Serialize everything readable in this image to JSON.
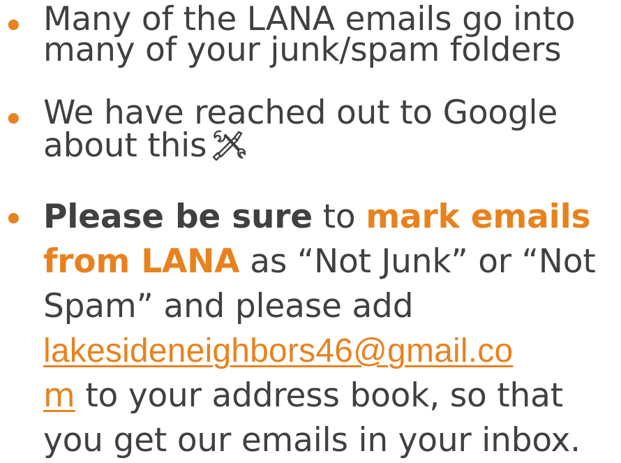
{
  "bullets": [
    {
      "lines": [
        "Many of the LANA emails go into",
        "many of your junk/spam folders"
      ]
    },
    {
      "line1": "We have reached out to Google",
      "line2": "about this",
      "icon": "tools-icon"
    },
    {
      "line1_bold": "Please be sure",
      "line1_mid": " to ",
      "line1_accent": "mark emails",
      "line2_accent": "from LANA",
      "line2_rest": " as “Not Junk” or “Not",
      "line3": "Spam” and please add",
      "email_part1": "lakesideneighbors46@gmail.co",
      "email_part2": "m",
      "line5_rest": " to your address book, so that",
      "line6": "you get our emails in your inbox."
    }
  ],
  "colors": {
    "text": "#404040",
    "accent": "#e8821e"
  }
}
